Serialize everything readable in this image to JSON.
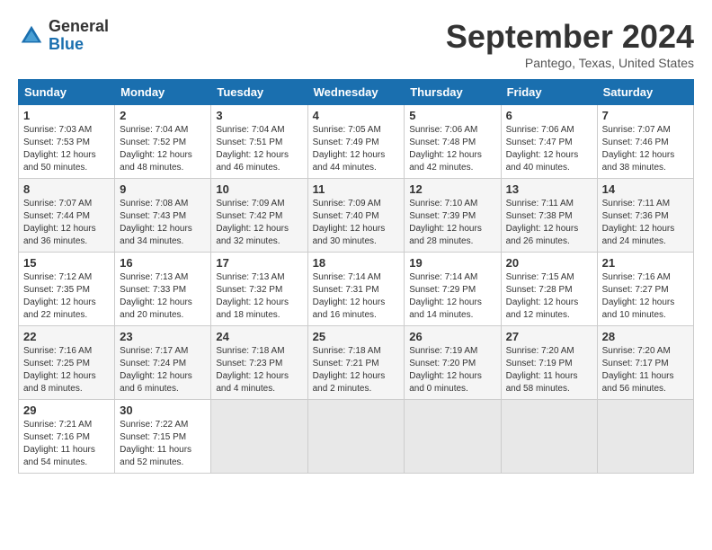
{
  "logo": {
    "general": "General",
    "blue": "Blue"
  },
  "title": "September 2024",
  "location": "Pantego, Texas, United States",
  "days_of_week": [
    "Sunday",
    "Monday",
    "Tuesday",
    "Wednesday",
    "Thursday",
    "Friday",
    "Saturday"
  ],
  "weeks": [
    [
      {
        "day": "1",
        "info": "Sunrise: 7:03 AM\nSunset: 7:53 PM\nDaylight: 12 hours\nand 50 minutes."
      },
      {
        "day": "2",
        "info": "Sunrise: 7:04 AM\nSunset: 7:52 PM\nDaylight: 12 hours\nand 48 minutes."
      },
      {
        "day": "3",
        "info": "Sunrise: 7:04 AM\nSunset: 7:51 PM\nDaylight: 12 hours\nand 46 minutes."
      },
      {
        "day": "4",
        "info": "Sunrise: 7:05 AM\nSunset: 7:49 PM\nDaylight: 12 hours\nand 44 minutes."
      },
      {
        "day": "5",
        "info": "Sunrise: 7:06 AM\nSunset: 7:48 PM\nDaylight: 12 hours\nand 42 minutes."
      },
      {
        "day": "6",
        "info": "Sunrise: 7:06 AM\nSunset: 7:47 PM\nDaylight: 12 hours\nand 40 minutes."
      },
      {
        "day": "7",
        "info": "Sunrise: 7:07 AM\nSunset: 7:46 PM\nDaylight: 12 hours\nand 38 minutes."
      }
    ],
    [
      {
        "day": "8",
        "info": "Sunrise: 7:07 AM\nSunset: 7:44 PM\nDaylight: 12 hours\nand 36 minutes."
      },
      {
        "day": "9",
        "info": "Sunrise: 7:08 AM\nSunset: 7:43 PM\nDaylight: 12 hours\nand 34 minutes."
      },
      {
        "day": "10",
        "info": "Sunrise: 7:09 AM\nSunset: 7:42 PM\nDaylight: 12 hours\nand 32 minutes."
      },
      {
        "day": "11",
        "info": "Sunrise: 7:09 AM\nSunset: 7:40 PM\nDaylight: 12 hours\nand 30 minutes."
      },
      {
        "day": "12",
        "info": "Sunrise: 7:10 AM\nSunset: 7:39 PM\nDaylight: 12 hours\nand 28 minutes."
      },
      {
        "day": "13",
        "info": "Sunrise: 7:11 AM\nSunset: 7:38 PM\nDaylight: 12 hours\nand 26 minutes."
      },
      {
        "day": "14",
        "info": "Sunrise: 7:11 AM\nSunset: 7:36 PM\nDaylight: 12 hours\nand 24 minutes."
      }
    ],
    [
      {
        "day": "15",
        "info": "Sunrise: 7:12 AM\nSunset: 7:35 PM\nDaylight: 12 hours\nand 22 minutes."
      },
      {
        "day": "16",
        "info": "Sunrise: 7:13 AM\nSunset: 7:33 PM\nDaylight: 12 hours\nand 20 minutes."
      },
      {
        "day": "17",
        "info": "Sunrise: 7:13 AM\nSunset: 7:32 PM\nDaylight: 12 hours\nand 18 minutes."
      },
      {
        "day": "18",
        "info": "Sunrise: 7:14 AM\nSunset: 7:31 PM\nDaylight: 12 hours\nand 16 minutes."
      },
      {
        "day": "19",
        "info": "Sunrise: 7:14 AM\nSunset: 7:29 PM\nDaylight: 12 hours\nand 14 minutes."
      },
      {
        "day": "20",
        "info": "Sunrise: 7:15 AM\nSunset: 7:28 PM\nDaylight: 12 hours\nand 12 minutes."
      },
      {
        "day": "21",
        "info": "Sunrise: 7:16 AM\nSunset: 7:27 PM\nDaylight: 12 hours\nand 10 minutes."
      }
    ],
    [
      {
        "day": "22",
        "info": "Sunrise: 7:16 AM\nSunset: 7:25 PM\nDaylight: 12 hours\nand 8 minutes."
      },
      {
        "day": "23",
        "info": "Sunrise: 7:17 AM\nSunset: 7:24 PM\nDaylight: 12 hours\nand 6 minutes."
      },
      {
        "day": "24",
        "info": "Sunrise: 7:18 AM\nSunset: 7:23 PM\nDaylight: 12 hours\nand 4 minutes."
      },
      {
        "day": "25",
        "info": "Sunrise: 7:18 AM\nSunset: 7:21 PM\nDaylight: 12 hours\nand 2 minutes."
      },
      {
        "day": "26",
        "info": "Sunrise: 7:19 AM\nSunset: 7:20 PM\nDaylight: 12 hours\nand 0 minutes."
      },
      {
        "day": "27",
        "info": "Sunrise: 7:20 AM\nSunset: 7:19 PM\nDaylight: 11 hours\nand 58 minutes."
      },
      {
        "day": "28",
        "info": "Sunrise: 7:20 AM\nSunset: 7:17 PM\nDaylight: 11 hours\nand 56 minutes."
      }
    ],
    [
      {
        "day": "29",
        "info": "Sunrise: 7:21 AM\nSunset: 7:16 PM\nDaylight: 11 hours\nand 54 minutes."
      },
      {
        "day": "30",
        "info": "Sunrise: 7:22 AM\nSunset: 7:15 PM\nDaylight: 11 hours\nand 52 minutes."
      },
      {
        "day": "",
        "info": ""
      },
      {
        "day": "",
        "info": ""
      },
      {
        "day": "",
        "info": ""
      },
      {
        "day": "",
        "info": ""
      },
      {
        "day": "",
        "info": ""
      }
    ]
  ]
}
